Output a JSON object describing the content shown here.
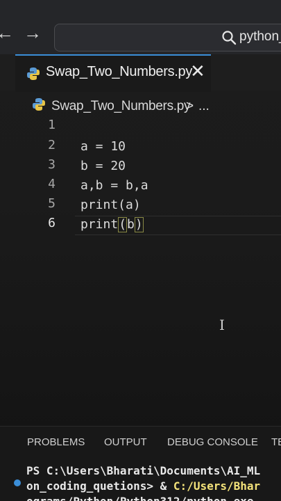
{
  "titlebar": {
    "back_glyph": "←",
    "forward_glyph": "→",
    "search_text": "python_"
  },
  "tab": {
    "label": "Swap_Two_Numbers.py",
    "close_glyph": "✕"
  },
  "breadcrumb": {
    "file": "Swap_Two_Numbers.py",
    "separator": ">",
    "more": "..."
  },
  "editor": {
    "lines": [
      {
        "number": "1",
        "code": ""
      },
      {
        "number": "2",
        "code": "a = 10"
      },
      {
        "number": "3",
        "code": "b = 20"
      },
      {
        "number": "4",
        "code": "a,b = b,a"
      },
      {
        "number": "5",
        "code": "print(a)"
      },
      {
        "number": "6",
        "code_before": "print",
        "open_paren": "(",
        "arg": "b",
        "close_paren": ")"
      }
    ],
    "cursor_glyph": "I"
  },
  "panel": {
    "tabs": [
      "PROBLEMS",
      "OUTPUT",
      "DEBUG CONSOLE",
      "TE"
    ],
    "terminal": {
      "line1": "PS C:\\Users\\Bharati\\Documents\\AI_ML",
      "line2_prefix": "on_coding_quetions> & ",
      "line2_path": "C:/Users/Bhar",
      "line3": "ograms/Python/Python312/python.exe"
    }
  },
  "colors": {
    "accent": "#3b8ed8",
    "bracket_highlight": "#8a8a45",
    "terminal_path": "#f3e27a"
  },
  "icons": [
    "python-file-icon",
    "search-icon",
    "close-icon"
  ]
}
